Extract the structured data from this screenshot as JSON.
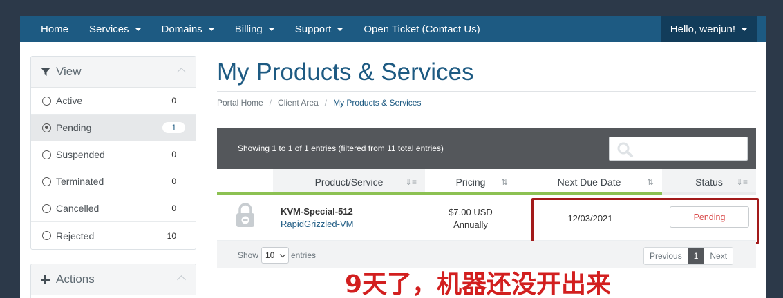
{
  "nav": {
    "items": [
      {
        "label": "Home",
        "caret": false
      },
      {
        "label": "Services",
        "caret": true
      },
      {
        "label": "Domains",
        "caret": true
      },
      {
        "label": "Billing",
        "caret": true
      },
      {
        "label": "Support",
        "caret": true
      },
      {
        "label": "Open Ticket (Contact Us)",
        "caret": false
      }
    ],
    "user": "Hello, wenjun!"
  },
  "sidebar": {
    "view_title": "View",
    "filters": [
      {
        "label": "Active",
        "count": "0",
        "selected": false
      },
      {
        "label": "Pending",
        "count": "1",
        "selected": true
      },
      {
        "label": "Suspended",
        "count": "0",
        "selected": false
      },
      {
        "label": "Terminated",
        "count": "0",
        "selected": false
      },
      {
        "label": "Cancelled",
        "count": "0",
        "selected": false
      },
      {
        "label": "Rejected",
        "count": "10",
        "selected": false
      }
    ],
    "actions_title": "Actions"
  },
  "page": {
    "title": "My Products & Services",
    "breadcrumb": [
      "Portal Home",
      "Client Area",
      "My Products & Services"
    ]
  },
  "table": {
    "info": "Showing 1 to 1 of 1 entries (filtered from 11 total entries)",
    "search_value": "",
    "headers": {
      "product": "Product/Service",
      "pricing": "Pricing",
      "due": "Next Due Date",
      "status": "Status"
    },
    "header_colors": {
      "icon": "#ffffff",
      "product": "#8cc152",
      "pricing": "#ffffff",
      "due": "#8cc152",
      "status": "#ffffff"
    },
    "rows": [
      {
        "product": "KVM-Special-512",
        "service": "RapidGrizzled-VM",
        "price": "$7.00 USD",
        "cycle": "Annually",
        "due": "12/03/2021",
        "status": "Pending"
      }
    ],
    "footer": {
      "show_label": "Show",
      "page_size": "10",
      "entries_label": "entries",
      "prev": "Previous",
      "page": "1",
      "next": "Next"
    }
  },
  "annotation": "9天了，机器还没开出来",
  "colors": {
    "brand": "#1d5a82",
    "annotation": "#d21f1f",
    "pending": "#d94b4b"
  }
}
